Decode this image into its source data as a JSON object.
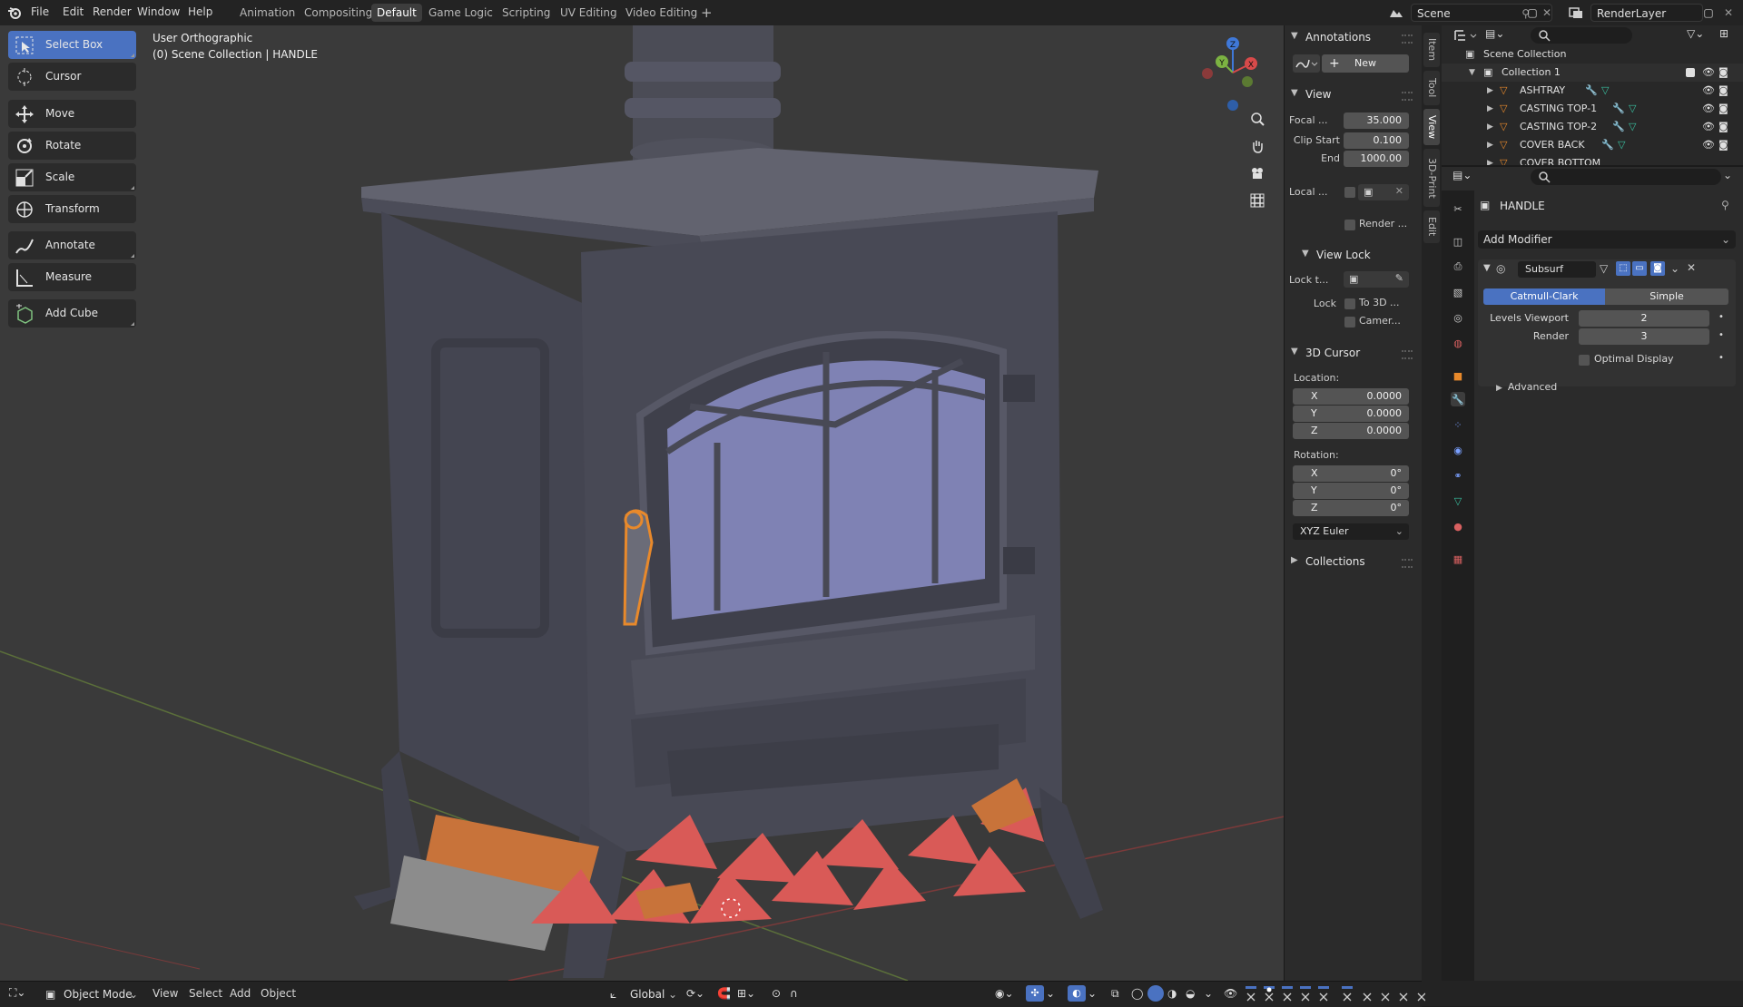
{
  "menus": [
    "File",
    "Edit",
    "Render",
    "Window",
    "Help"
  ],
  "workspaces": [
    {
      "label": "Animation",
      "active": false
    },
    {
      "label": "Compositing",
      "active": false
    },
    {
      "label": "Default",
      "active": true
    },
    {
      "label": "Game Logic",
      "active": false
    },
    {
      "label": "Scripting",
      "active": false
    },
    {
      "label": "UV Editing",
      "active": false
    },
    {
      "label": "Video Editing",
      "active": false
    }
  ],
  "add_workspace": "+",
  "scene_name": "Scene",
  "render_layer": "RenderLayer",
  "viewport": {
    "view_name": "User Orthographic",
    "context": "(0) Scene Collection | HANDLE",
    "gizmo_axes": [
      "Z",
      "Y",
      "X"
    ]
  },
  "tools": [
    {
      "label": "Select Box",
      "icon": "select-box-icon",
      "active": true
    },
    {
      "label": "Cursor",
      "icon": "cursor-icon",
      "active": false
    },
    {
      "label": "Move",
      "icon": "move-icon",
      "active": false
    },
    {
      "label": "Rotate",
      "icon": "rotate-icon",
      "active": false
    },
    {
      "label": "Scale",
      "icon": "scale-icon",
      "active": false
    },
    {
      "label": "Transform",
      "icon": "transform-icon",
      "active": false
    },
    {
      "label": "Annotate",
      "icon": "annotate-icon",
      "active": false
    },
    {
      "label": "Measure",
      "icon": "measure-icon",
      "active": false
    },
    {
      "label": "Add Cube",
      "icon": "add-cube-icon",
      "active": false
    }
  ],
  "npanel": {
    "annotations": {
      "title": "Annotations",
      "new_label": "New"
    },
    "view": {
      "title": "View",
      "focal_label": "Focal ...",
      "focal_value": "35.000",
      "clip_start_label": "Clip Start",
      "clip_start_value": "0.100",
      "end_label": "End",
      "end_value": "1000.00",
      "local_label": "Local ...",
      "render_label": "Render ..."
    },
    "view_lock": {
      "title": "View Lock",
      "lock_to_label": "Lock t...",
      "lock_label": "Lock",
      "to3d_label": "To 3D ...",
      "camera_label": "Camer..."
    },
    "cursor": {
      "title": "3D Cursor",
      "location_label": "Location:",
      "location": [
        {
          "axis": "X",
          "value": "0.0000"
        },
        {
          "axis": "Y",
          "value": "0.0000"
        },
        {
          "axis": "Z",
          "value": "0.0000"
        }
      ],
      "rotation_label": "Rotation:",
      "rotation": [
        {
          "axis": "X",
          "value": "0°"
        },
        {
          "axis": "Y",
          "value": "0°"
        },
        {
          "axis": "Z",
          "value": "0°"
        }
      ],
      "rotation_mode": "XYZ Euler"
    },
    "collections": {
      "title": "Collections"
    }
  },
  "vtabs": [
    "Item",
    "Tool",
    "View",
    "3D-Print",
    "Edit"
  ],
  "outliner": {
    "root": "Scene Collection",
    "collection": "Collection 1",
    "items": [
      "ASHTRAY",
      "CASTING TOP-1",
      "CASTING TOP-2",
      "COVER BACK",
      "COVER BOTTOM"
    ]
  },
  "properties": {
    "object_name": "HANDLE",
    "add_modifier": "Add Modifier",
    "modifier_name": "Subsurf",
    "subdiv_types": [
      {
        "label": "Catmull-Clark",
        "active": true
      },
      {
        "label": "Simple",
        "active": false
      }
    ],
    "levels_viewport_label": "Levels Viewport",
    "levels_viewport_value": "2",
    "render_label": "Render",
    "render_value": "3",
    "optimal_display": "Optimal Display",
    "advanced": "Advanced"
  },
  "bottom": {
    "mode": "Object Mode",
    "menus": [
      "View",
      "Select",
      "Add",
      "Object"
    ],
    "orientation": "Global"
  },
  "colors": {
    "accent": "#4a72c1",
    "selected_outline": "#e8892b",
    "stove": "#4b4c56",
    "glass": "#7f82b4",
    "logs_red": "#d95a57",
    "logs_orange": "#c8733a"
  }
}
